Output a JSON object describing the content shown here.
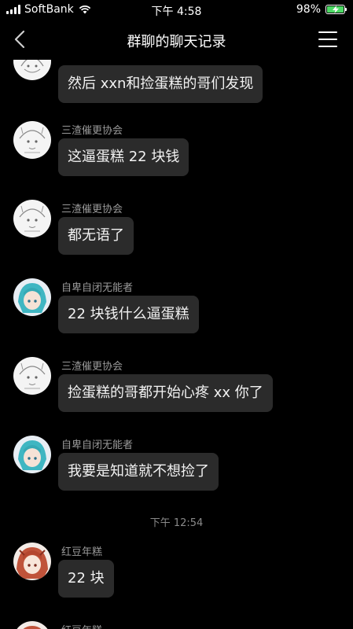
{
  "status_bar": {
    "carrier": "SoftBank",
    "time": "下午 4:58",
    "battery_percent": "98%",
    "battery_level": 0.98
  },
  "nav": {
    "title": "群聊的聊天记录"
  },
  "messages": [
    {
      "sender": "",
      "text": "然后 xxn和捡蛋糕的哥们发现",
      "avatar": "sketch-avatar"
    },
    {
      "sender": "三渣催更协会",
      "text": "这逼蛋糕 22 块钱",
      "avatar": "sketch-avatar"
    },
    {
      "sender": "三渣催更协会",
      "text": "都无语了",
      "avatar": "sketch-avatar"
    },
    {
      "sender": "自卑自闭无能者",
      "text": "22 块钱什么逼蛋糕",
      "avatar": "teal-hair-avatar"
    },
    {
      "sender": "三渣催更协会",
      "text": "捡蛋糕的哥都开始心疼 xx 你了",
      "avatar": "sketch-avatar"
    },
    {
      "sender": "自卑自闭无能者",
      "text": "我要是知道就不想捡了",
      "avatar": "teal-hair-avatar"
    },
    {
      "sender": "红豆年糕",
      "text": "22 块",
      "avatar": "red-hair-avatar"
    },
    {
      "sender": "红豆年糕",
      "text": "",
      "avatar": "red-hair-avatar"
    }
  ],
  "timestamp": "下午 12:54",
  "colors": {
    "background": "#000000",
    "bubble": "#2b2b2b",
    "sender_text": "#9a9a9a",
    "battery_fill": "#4cd964"
  }
}
